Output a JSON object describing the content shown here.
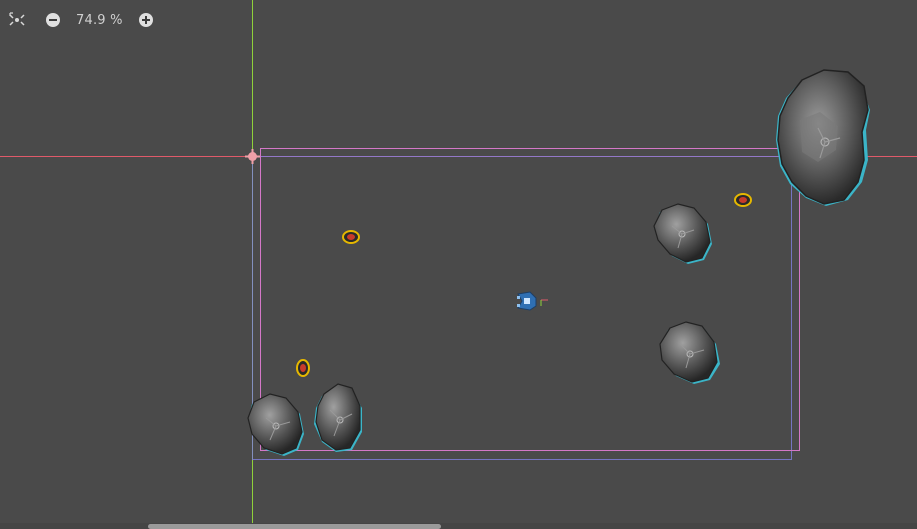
{
  "editor": {
    "zoom_label": "74.9 %"
  },
  "colors": {
    "background": "#4a4a4a",
    "x_axis": "#e05a6a",
    "y_axis": "#8fd13a",
    "viewport_rect": "#d478c8",
    "secondary_rect": "#8080ff",
    "rock_outline": "#3bb5c8",
    "powerup_ring": "#e6b800",
    "powerup_core": "#c83a2a"
  },
  "icons": {
    "center_view": "center-view-icon",
    "zoom_out": "zoom-out-icon",
    "zoom_in": "zoom-in-icon"
  },
  "scene": {
    "rocks": [
      "large",
      "medium",
      "medium",
      "small",
      "small"
    ],
    "powerups": 3,
    "player_ship": "player-ship"
  }
}
